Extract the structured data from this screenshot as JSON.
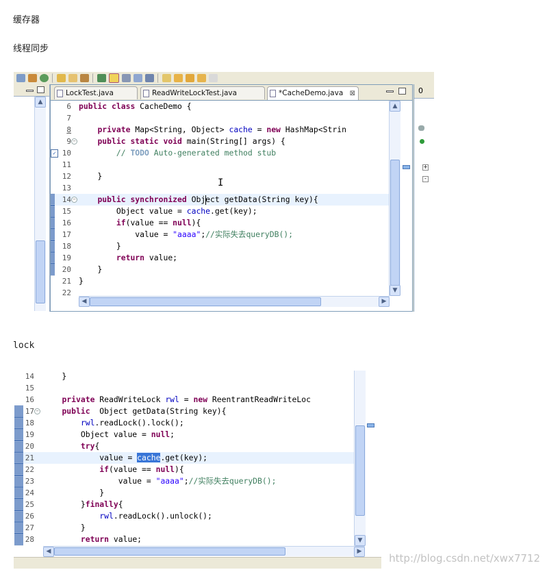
{
  "headings": {
    "cache": "缓存器",
    "thread_sync": "线程同步",
    "lock": "lock"
  },
  "screenshot1": {
    "tabs": [
      {
        "label": "LockTest.java",
        "active": false
      },
      {
        "label": "ReadWriteLockTest.java",
        "active": false
      },
      {
        "label": "*CacheDemo.java",
        "active": true
      }
    ],
    "right_pane_tab": "0",
    "lines": [
      {
        "n": "6",
        "code": "public class CacheDemo {"
      },
      {
        "n": "7",
        "code": ""
      },
      {
        "n": "8",
        "code": "    private Map<String, Object> cache = new HashMap<Strin"
      },
      {
        "n": "9",
        "code": "    public static void main(String[] args) {"
      },
      {
        "n": "10",
        "code": "        // TODO Auto-generated method stub"
      },
      {
        "n": "11",
        "code": ""
      },
      {
        "n": "12",
        "code": "    }"
      },
      {
        "n": "13",
        "code": ""
      },
      {
        "n": "14",
        "code": "    public synchronized Object getData(String key){"
      },
      {
        "n": "15",
        "code": "        Object value = cache.get(key);"
      },
      {
        "n": "16",
        "code": "        if(value == null){"
      },
      {
        "n": "17",
        "code": "            value = \"aaaa\";//实际失去queryDB();"
      },
      {
        "n": "18",
        "code": "        }"
      },
      {
        "n": "19",
        "code": "        return value;"
      },
      {
        "n": "20",
        "code": "    }"
      },
      {
        "n": "21",
        "code": "}"
      },
      {
        "n": "22",
        "code": ""
      }
    ]
  },
  "screenshot2": {
    "lines": [
      {
        "n": "14",
        "code": "    }"
      },
      {
        "n": "15",
        "code": ""
      },
      {
        "n": "16",
        "code": "    private ReadWriteLock rwl = new ReentrantReadWriteLoc"
      },
      {
        "n": "17",
        "code": "    public  Object getData(String key){"
      },
      {
        "n": "18",
        "code": "        rwl.readLock().lock();"
      },
      {
        "n": "19",
        "code": "        Object value = null;"
      },
      {
        "n": "20",
        "code": "        try{"
      },
      {
        "n": "21",
        "code": "            value = cache.get(key);"
      },
      {
        "n": "22",
        "code": "            if(value == null){"
      },
      {
        "n": "23",
        "code": "                value = \"aaaa\";//实际失去queryDB();"
      },
      {
        "n": "24",
        "code": "            }"
      },
      {
        "n": "25",
        "code": "        }finally{"
      },
      {
        "n": "26",
        "code": "            rwl.readLock().unlock();"
      },
      {
        "n": "27",
        "code": "        }"
      },
      {
        "n": "28",
        "code": "        return value;"
      }
    ]
  },
  "watermark": "http://blog.csdn.net/xwx7712",
  "colors": {
    "keyword": "#7f0055",
    "field": "#0000c0",
    "string": "#2a00ff",
    "comment": "#3f7f5f",
    "selection": "#3875d7",
    "current_line": "#e8f2fe"
  }
}
